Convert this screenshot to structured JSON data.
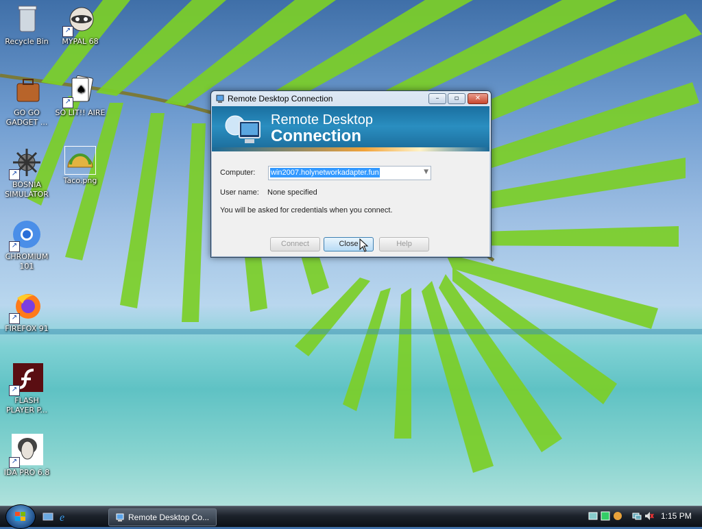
{
  "desktop": {
    "icons": [
      {
        "label": "Recycle Bin"
      },
      {
        "label": "MYPAL 68"
      },
      {
        "label": "GO GO GADGET ..."
      },
      {
        "label": "SO LIT!! AIRE"
      },
      {
        "label": "BOSNIA SIMULATOR"
      },
      {
        "label": "Taco.png"
      },
      {
        "label": "CHROMIUM 101"
      },
      {
        "label": "FIREFOX 91"
      },
      {
        "label": "FLASH PLAYER P..."
      },
      {
        "label": "IDA PRO 6.8"
      }
    ]
  },
  "window": {
    "title": "Remote Desktop Connection",
    "banner_line1": "Remote Desktop",
    "banner_line2": "Connection",
    "computer_label": "Computer:",
    "computer_value": "win2007.holynetworkadapter.fun",
    "username_label": "User name:",
    "username_value": "None specified",
    "info_text": "You will be asked for credentials when you connect.",
    "buttons": {
      "connect": "Connect",
      "close": "Close",
      "help": "Help"
    },
    "controls": {
      "minimize": "–",
      "maximize": "▫",
      "close": "✕"
    }
  },
  "taskbar": {
    "task_label": "Remote Desktop Co...",
    "clock": "1:15 PM"
  },
  "icons": {
    "start": "windows-flag-icon",
    "quicklaunch": [
      "show-desktop-icon",
      "internet-explorer-icon"
    ],
    "tray": [
      "network-icon",
      "security-icon",
      "speaker-muted-icon"
    ]
  },
  "colors": {
    "banner": "#1a6fa0",
    "selection": "#3399ff",
    "taskbar": "#1c222b"
  }
}
